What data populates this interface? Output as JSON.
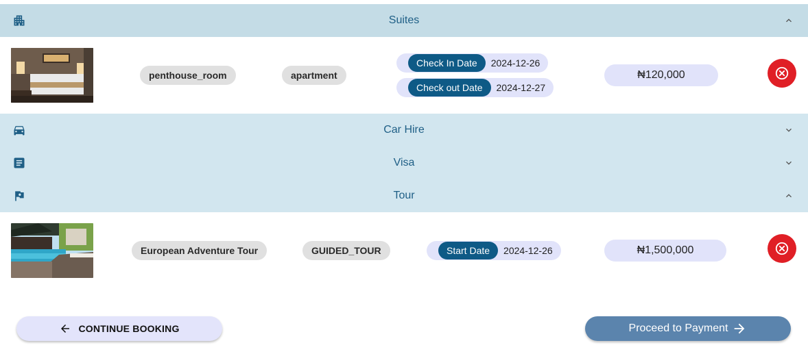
{
  "sections": {
    "suites": {
      "title": "Suites",
      "icon": "building-icon",
      "expanded": true
    },
    "car_hire": {
      "title": "Car Hire",
      "icon": "car-icon",
      "expanded": false
    },
    "visa": {
      "title": "Visa",
      "icon": "document-icon",
      "expanded": false
    },
    "tour": {
      "title": "Tour",
      "icon": "flag-icon",
      "expanded": true
    }
  },
  "suite_item": {
    "name": "penthouse_room",
    "type": "apartment",
    "check_in_label": "Check In Date",
    "check_in_value": "2024-12-26",
    "check_out_label": "Check out Date",
    "check_out_value": "2024-12-27",
    "price": "₦120,000"
  },
  "tour_item": {
    "name": "European Adventure Tour",
    "type": "GUIDED_TOUR",
    "start_label": "Start Date",
    "start_value": "2024-12-26",
    "price": "₦1,500,000"
  },
  "actions": {
    "continue_label": "CONTINUE BOOKING",
    "proceed_label": "Proceed to Payment"
  },
  "colors": {
    "header_bg": "#c4dce6",
    "header_text": "#1f5f86",
    "date_label_bg": "#0e5a86",
    "chip_bg": "#e1e3fa",
    "remove_red": "#e01f26",
    "pay_button": "#5b84ad"
  }
}
